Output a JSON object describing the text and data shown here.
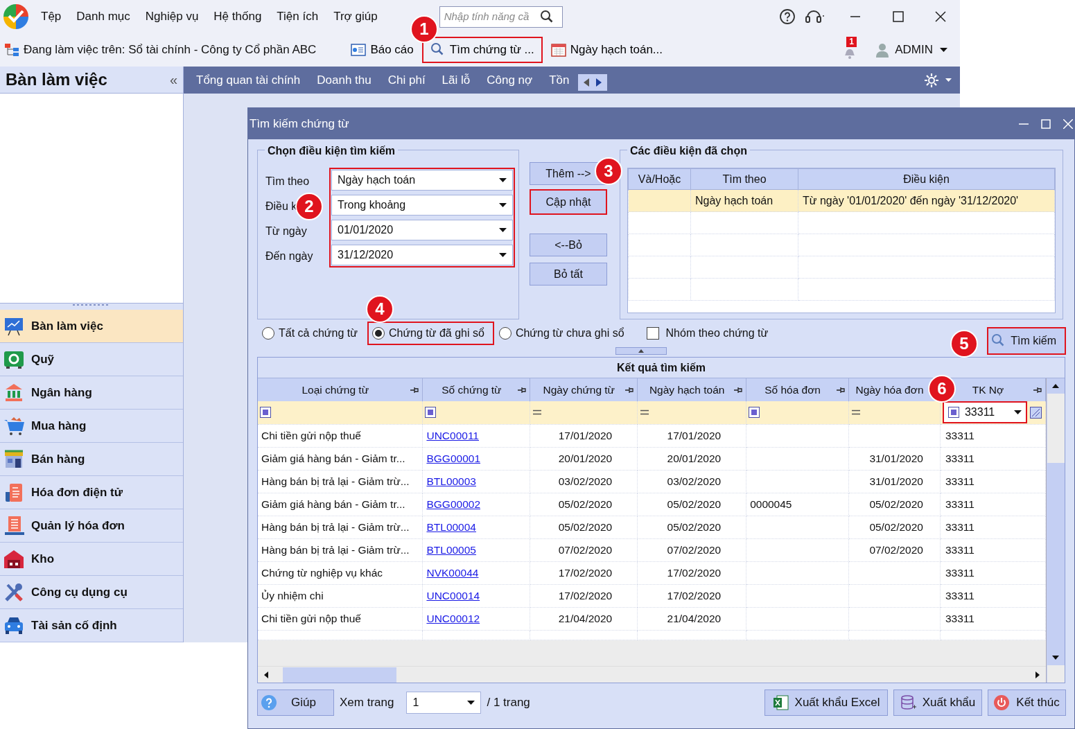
{
  "app": {
    "menu": [
      "Tệp",
      "Danh mục",
      "Nghiệp vụ",
      "Hệ thống",
      "Tiện ích",
      "Trợ giúp"
    ],
    "search": {
      "placeholder": "Nhập tính năng cầ"
    },
    "workspace": "Đang làm việc trên: Sổ tài chính - Công ty Cổ phần ABC",
    "toolbar": [
      {
        "label": "Báo cáo",
        "highlighted": false
      },
      {
        "label": "Tìm chứng từ ...",
        "highlighted": true
      },
      {
        "label": "Ngày hạch toán...",
        "highlighted": false
      }
    ],
    "notifications": "1",
    "user": "ADMIN",
    "sidebar": {
      "title": "Bàn làm việc",
      "collapse": "«",
      "items": [
        {
          "label": "Bàn làm việc",
          "selected": true
        },
        {
          "label": "Quỹ",
          "selected": false
        },
        {
          "label": "Ngân hàng",
          "selected": false
        },
        {
          "label": "Mua hàng",
          "selected": false
        },
        {
          "label": "Bán hàng",
          "selected": false
        },
        {
          "label": "Hóa đơn điện tử",
          "selected": false
        },
        {
          "label": "Quản lý hóa đơn",
          "selected": false
        },
        {
          "label": "Kho",
          "selected": false
        },
        {
          "label": "Công cụ dụng cụ",
          "selected": false
        },
        {
          "label": "Tài sản cố định",
          "selected": false
        }
      ]
    },
    "tabs": [
      "Tổng quan tài chính",
      "Doanh thu",
      "Chi phí",
      "Lãi lỗ",
      "Công nợ",
      "Tồn"
    ]
  },
  "dialog": {
    "title": "Tìm kiếm chứng từ",
    "criteria": {
      "title": "Chọn điều kiện tìm kiếm",
      "highlighted": true,
      "fields": [
        {
          "label": "Tìm theo",
          "value": "Ngày hạch toán"
        },
        {
          "label": "Điều k",
          "value": "Trong khoảng"
        },
        {
          "label": "Từ ngày",
          "value": "01/01/2020"
        },
        {
          "label": "Đến ngày",
          "value": "31/12/2020"
        }
      ]
    },
    "actions": [
      {
        "label": "Thêm -->",
        "highlighted": false
      },
      {
        "label": "Cập nhật",
        "highlighted": true
      },
      {
        "label": "<--Bỏ",
        "highlighted": false
      },
      {
        "label": "Bỏ tất",
        "highlighted": false
      }
    ],
    "conditions": {
      "title": "Các điều kiện đã chọn",
      "columns": [
        "Và/Hoặc",
        "Tìm theo",
        "Điều kiện"
      ],
      "rows": [
        {
          "search_by": "Ngày hạch toán",
          "condition": "Từ ngày '01/01/2020' đến ngày '31/12/2020'",
          "selected": true
        }
      ]
    },
    "scope": [
      {
        "label": "Tất cả chứng từ",
        "selected": false,
        "highlighted": false
      },
      {
        "label": "Chứng từ đã ghi sổ",
        "selected": true,
        "highlighted": true
      },
      {
        "label": "Chứng từ chưa ghi sổ",
        "selected": false,
        "highlighted": false
      }
    ],
    "group_by": {
      "label": "Nhóm theo chứng từ",
      "checked": false
    },
    "search_button": {
      "label": "Tìm kiếm",
      "highlighted": true
    },
    "results": {
      "title": "Kết quả tìm kiếm",
      "columns": [
        "Loại chứng từ",
        "Số chứng từ",
        "Ngày chứng từ",
        "Ngày hạch toán",
        "Số hóa đơn",
        "Ngày hóa đơn",
        "TK Nợ"
      ],
      "filters": [
        {
          "kind": "square"
        },
        {
          "kind": "square"
        },
        {
          "kind": "equals"
        },
        {
          "kind": "equals"
        },
        {
          "kind": "square"
        },
        {
          "kind": "equals"
        },
        {
          "kind": "dropdown",
          "value": "33311",
          "highlighted": true
        }
      ],
      "rows": [
        {
          "type": "Chi tiền gửi nộp thuế",
          "number": "UNC00011",
          "doc_date": "17/01/2020",
          "post_date": "17/01/2020",
          "debit": "33311"
        },
        {
          "type": "Giảm giá hàng bán - Giảm tr...",
          "number": "BGG00001",
          "doc_date": "20/01/2020",
          "post_date": "20/01/2020",
          "invoice_date": "31/01/2020",
          "debit": "33311"
        },
        {
          "type": "Hàng bán bị trả lại - Giảm trừ...",
          "number": "BTL00003",
          "doc_date": "03/02/2020",
          "post_date": "03/02/2020",
          "invoice_date": "31/01/2020",
          "debit": "33311"
        },
        {
          "type": "Giảm giá hàng bán - Giảm tr...",
          "number": "BGG00002",
          "doc_date": "05/02/2020",
          "post_date": "05/02/2020",
          "invoice_no": "0000045",
          "invoice_date": "05/02/2020",
          "debit": "33311"
        },
        {
          "type": "Hàng bán bị trả lại - Giảm trừ...",
          "number": "BTL00004",
          "doc_date": "05/02/2020",
          "post_date": "05/02/2020",
          "invoice_date": "05/02/2020",
          "debit": "33311"
        },
        {
          "type": "Hàng bán bị trả lại - Giảm trừ...",
          "number": "BTL00005",
          "doc_date": "07/02/2020",
          "post_date": "07/02/2020",
          "invoice_date": "07/02/2020",
          "debit": "33311"
        },
        {
          "type": "Chứng từ nghiệp vụ khác",
          "number": "NVK00044",
          "doc_date": "17/02/2020",
          "post_date": "17/02/2020",
          "debit": "33311"
        },
        {
          "type": "Ủy nhiệm chi",
          "number": "UNC00014",
          "doc_date": "17/02/2020",
          "post_date": "17/02/2020",
          "debit": "33311"
        },
        {
          "type": "Chi tiền gửi nộp thuế",
          "number": "UNC00012",
          "doc_date": "21/04/2020",
          "post_date": "21/04/2020",
          "debit": "33311"
        }
      ]
    },
    "footer": {
      "help": "Giúp",
      "page_label": "Xem trang",
      "page": "1",
      "page_total": "/ 1 trang",
      "buttons": [
        "Xuất khẩu Excel",
        "Xuất khẩu",
        "Kết thúc"
      ]
    }
  },
  "callouts": [
    "1",
    "2",
    "3",
    "4",
    "5",
    "6"
  ]
}
